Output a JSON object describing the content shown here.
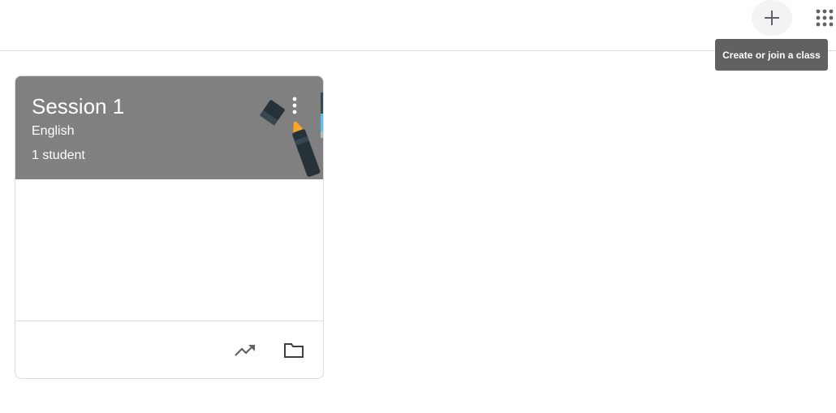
{
  "topbar": {
    "add_icon": "plus-icon",
    "apps_icon": "apps-grid-icon",
    "tooltip": "Create or join a class"
  },
  "class_card": {
    "title": "Session 1",
    "subject": "English",
    "students": "1 student",
    "header_color": "#808080",
    "menu_icon": "more-vert-icon",
    "footer_icons": [
      "trending-up-icon",
      "folder-icon"
    ]
  }
}
